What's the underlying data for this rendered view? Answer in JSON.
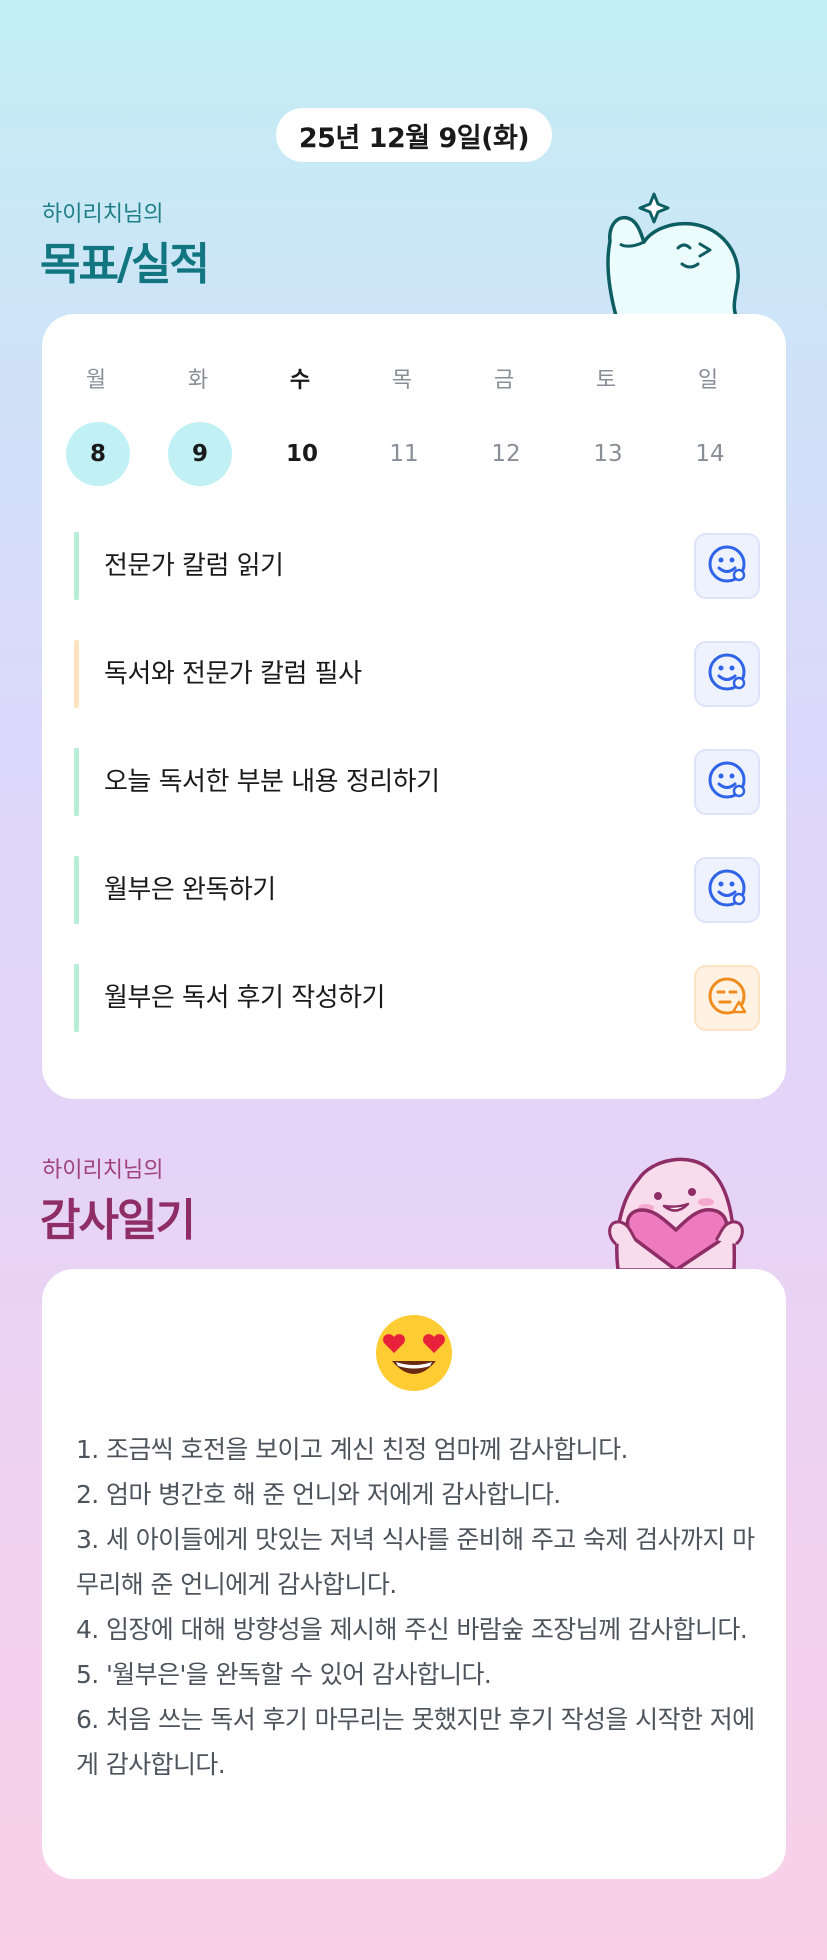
{
  "date": "25년 12월 9일(화)",
  "goals_section": {
    "subtitle": "하이리치님의",
    "title": "목표/실적"
  },
  "week": [
    {
      "label": "월",
      "num": "8",
      "state": "done"
    },
    {
      "label": "화",
      "num": "9",
      "state": "done"
    },
    {
      "label": "수",
      "num": "10",
      "state": "today"
    },
    {
      "label": "목",
      "num": "11",
      "state": "future"
    },
    {
      "label": "금",
      "num": "12",
      "state": "future"
    },
    {
      "label": "토",
      "num": "13",
      "state": "future"
    },
    {
      "label": "일",
      "num": "14",
      "state": "future"
    }
  ],
  "goals": [
    {
      "text": "전문가 칼럼 읽기",
      "bar_color": "#b7ecd9",
      "status": "smile-icon",
      "status_color": "#2f63e8"
    },
    {
      "text": "독서와 전문가 칼럼 필사",
      "bar_color": "#ffe3bf",
      "status": "smile-icon",
      "status_color": "#2f63e8"
    },
    {
      "text": "오늘 독서한 부분 내용 정리하기",
      "bar_color": "#b7ecd9",
      "status": "smile-icon",
      "status_color": "#2f63e8"
    },
    {
      "text": "월부은 완독하기",
      "bar_color": "#b7ecd9",
      "status": "smile-icon",
      "status_color": "#2f63e8"
    },
    {
      "text": "월부은 독서 후기 작성하기",
      "bar_color": "#b7ecd9",
      "status": "meh-icon",
      "status_color": "#f08c1e"
    }
  ],
  "thanks_section": {
    "subtitle": "하이리치님의",
    "title": "감사일기",
    "emoji": "heart-eyes-emoji",
    "lines": [
      "1. 조금씩 호전을 보이고 계신 친정 엄마께 감사합니다.",
      "2. 엄마 병간호 해 준 언니와 저에게 감사합니다.",
      "3. 세 아이들에게 맛있는 저녁 식사를 준비해 주고 숙제 검사까지 마무리해 준 언니에게 감사합니다.",
      "4. 임장에 대해 방향성을 제시해 주신 바람숲 조장님께 감사합니다.",
      "5. '월부은'을 완독할 수 있어 감사합니다.",
      "6. 처음 쓰는 독서 후기 마무리는 못했지만 후기 작성을 시작한 저에게 감사합니다."
    ]
  }
}
